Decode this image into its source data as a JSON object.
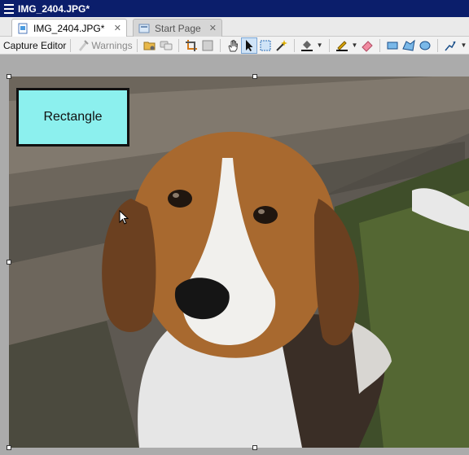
{
  "window": {
    "title": "IMG_2404.JPG*"
  },
  "tabs": [
    {
      "label": "IMG_2404.JPG*",
      "close": "✕",
      "icon": "image-file-icon"
    },
    {
      "label": "Start Page",
      "close": "✕",
      "icon": "start-page-icon"
    }
  ],
  "toolbar": {
    "capture_editor": "Capture Editor",
    "warnings": "Warnings"
  },
  "canvas": {
    "shape_label": "Rectangle"
  },
  "colors": {
    "titlebar": "#0b1e6b",
    "shape_fill": "#8cf0ee",
    "selection_tool_active": "#cfe3f7"
  }
}
